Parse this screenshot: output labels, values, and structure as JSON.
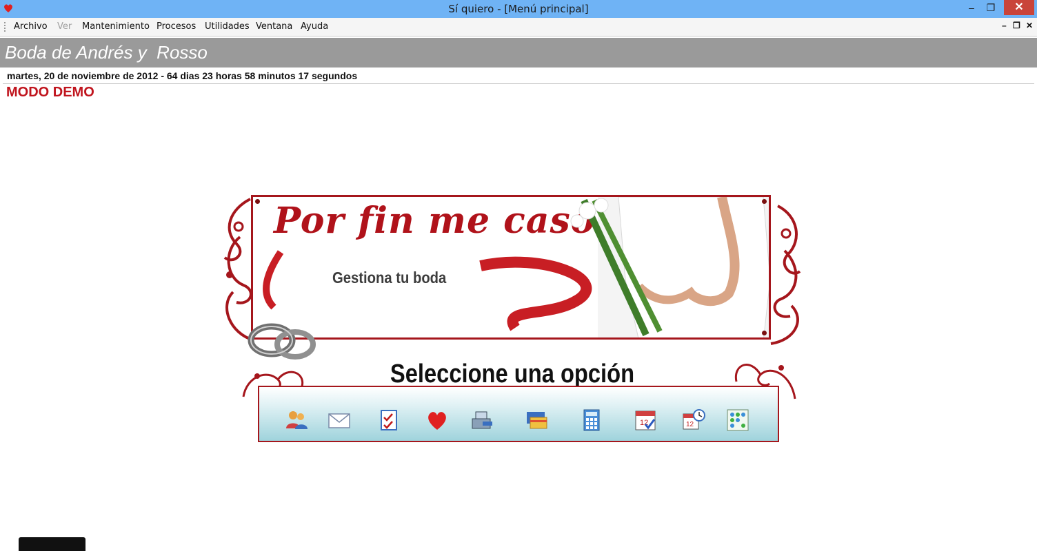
{
  "window": {
    "title": "Sí quiero - [Menú principal]",
    "minimize": "–",
    "maximize": "❐",
    "close": "✕"
  },
  "menu": {
    "items": [
      "Archivo",
      "Ver",
      "Mantenimiento",
      "Procesos",
      "Utilidades",
      "Ventana",
      "Ayuda"
    ],
    "mdi_minimize": "–",
    "mdi_restore": "❐",
    "mdi_close": "✕"
  },
  "header": {
    "wedding_title": "Boda de Andrés y  Rosso"
  },
  "status": {
    "date_countdown": "martes, 20 de noviembre de 2012 - 64 dias 23 horas 58 minutos 17 segundos",
    "mode": "MODO DEMO"
  },
  "banner": {
    "slogan": "Por fin me caso",
    "subtitle": "Gestiona tu boda",
    "select_title": "Seleccione una opción"
  },
  "toolbar_icons": [
    "guests-icon",
    "envelope-icon",
    "checklist-icon",
    "heart-icon",
    "cash-register-icon",
    "credit-cards-icon",
    "calculator-icon",
    "calendar-check-icon",
    "calendar-clock-icon",
    "seating-plan-icon"
  ],
  "colors": {
    "accent_red": "#a5161c",
    "demo_red": "#c0141d",
    "titlebar_blue": "#6fb3f5",
    "header_gray": "#9a9a9a"
  }
}
